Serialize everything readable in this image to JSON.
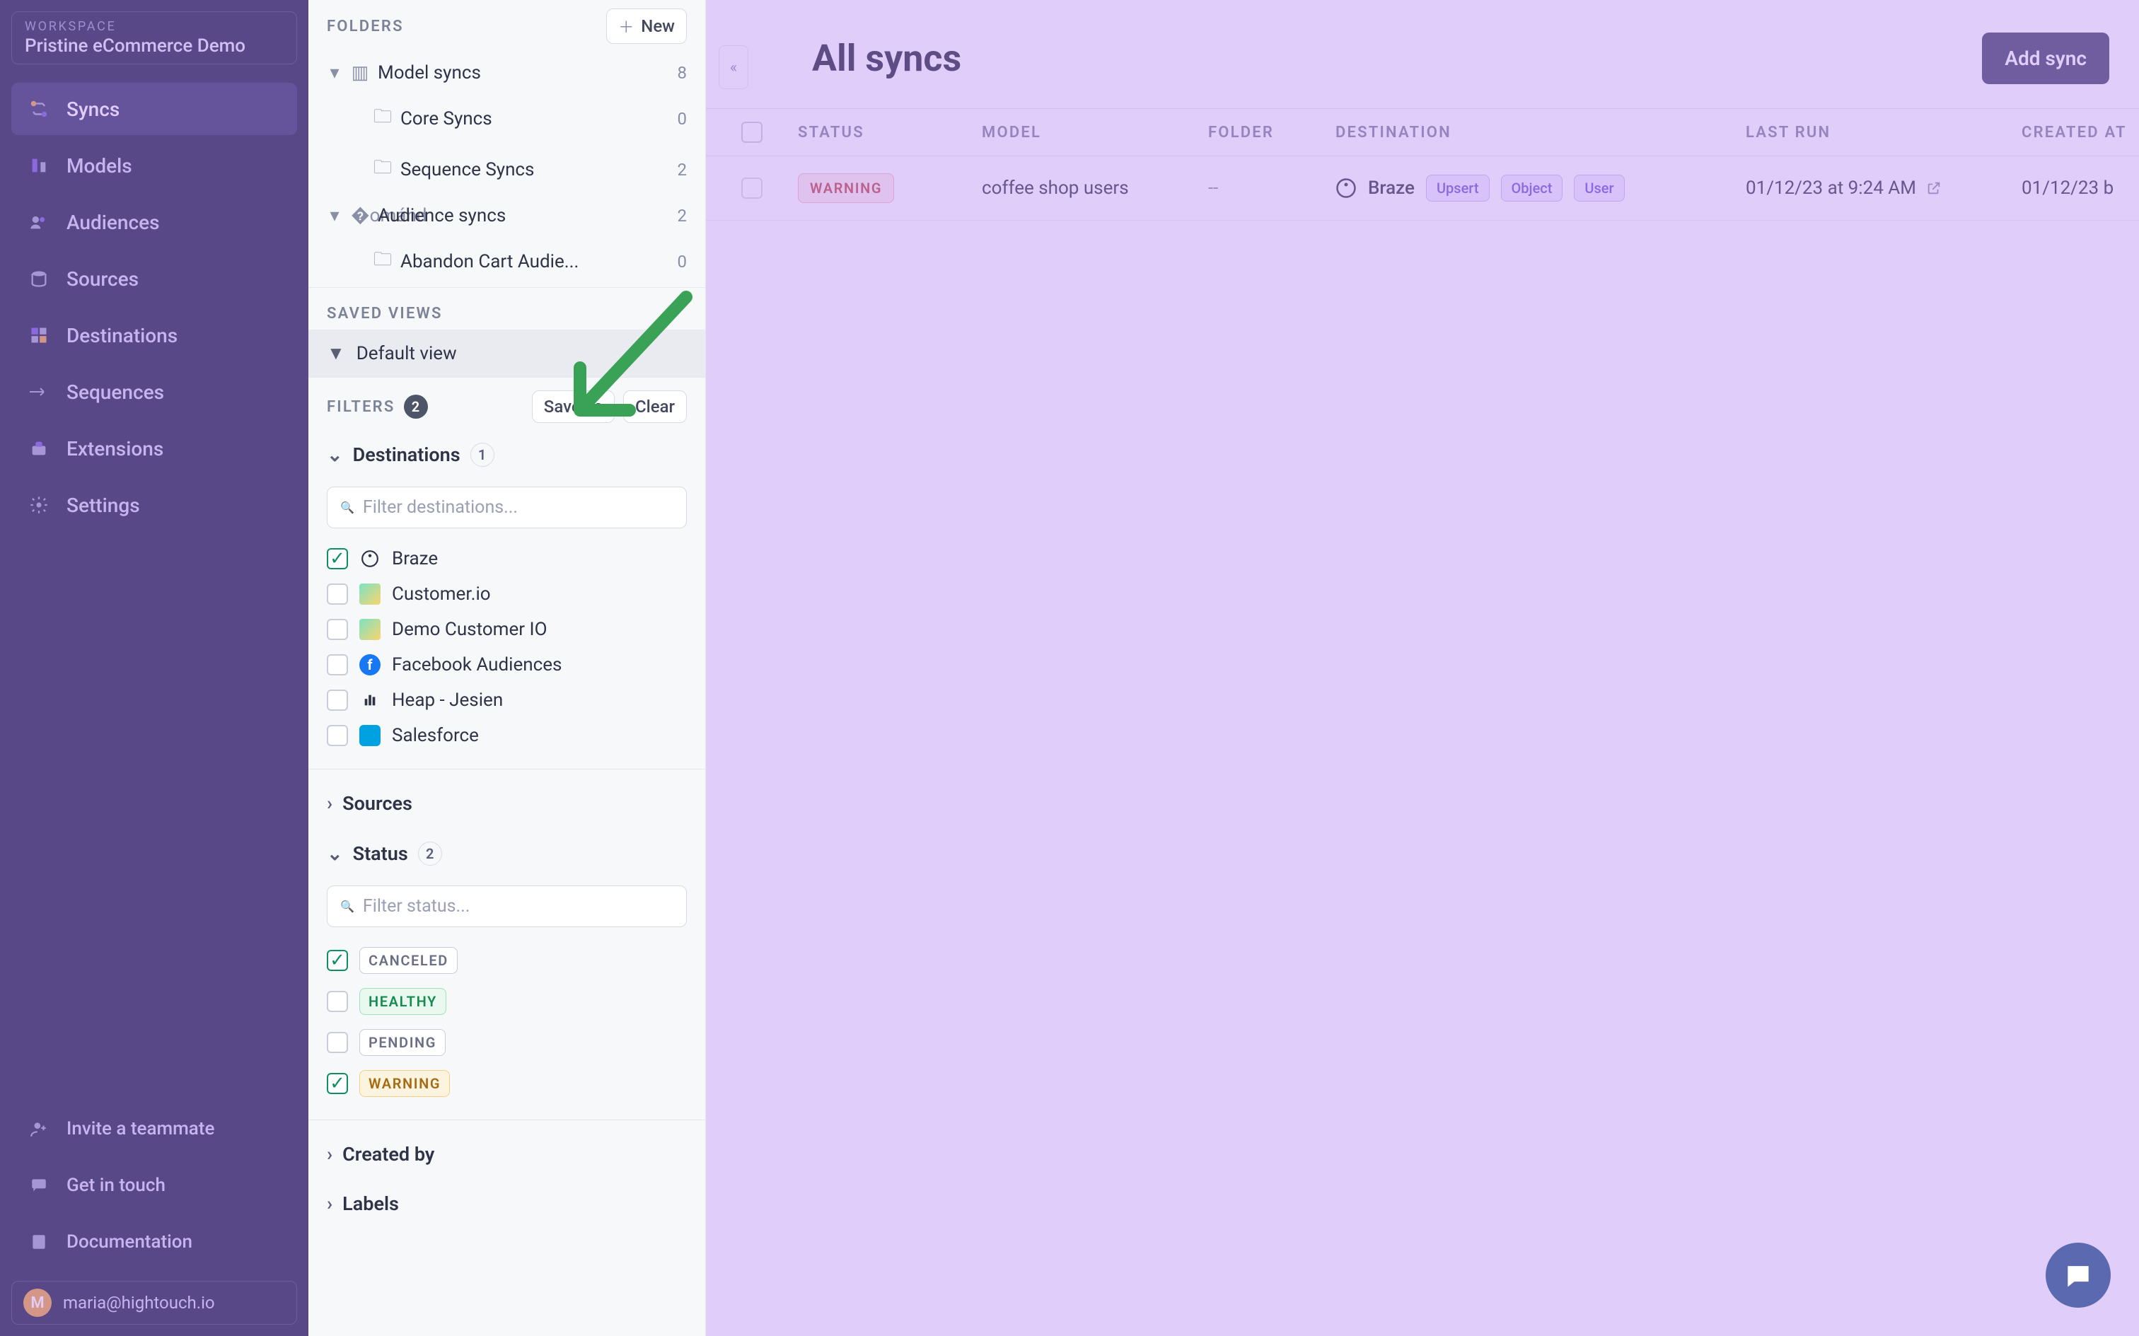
{
  "workspace": {
    "label": "WORKSPACE",
    "name": "Pristine eCommerce Demo"
  },
  "nav": {
    "syncs": "Syncs",
    "models": "Models",
    "audiences": "Audiences",
    "sources": "Sources",
    "destinations": "Destinations",
    "sequences": "Sequences",
    "extensions": "Extensions",
    "settings": "Settings"
  },
  "sidebar_bottom": {
    "invite": "Invite a teammate",
    "contact": "Get in touch",
    "docs": "Documentation"
  },
  "user": {
    "initial": "M",
    "email": "maria@hightouch.io"
  },
  "folders": {
    "heading": "FOLDERS",
    "new_btn": "New",
    "items": [
      {
        "label": "Model syncs",
        "count": "8",
        "kind": "parent"
      },
      {
        "label": "Core Syncs",
        "count": "0",
        "kind": "child"
      },
      {
        "label": "Sequence Syncs",
        "count": "2",
        "kind": "child"
      },
      {
        "label": "Audience syncs",
        "count": "2",
        "kind": "parent"
      },
      {
        "label": "Abandon Cart Audie...",
        "count": "0",
        "kind": "child"
      }
    ]
  },
  "saved_views": {
    "heading": "SAVED VIEWS",
    "default": "Default view"
  },
  "filters": {
    "heading": "FILTERS",
    "count": "2",
    "save_as": "Save as",
    "clear": "Clear",
    "destinations": {
      "label": "Destinations",
      "count": "1",
      "placeholder": "Filter destinations...",
      "options": [
        {
          "label": "Braze",
          "checked": true
        },
        {
          "label": "Customer.io",
          "checked": false
        },
        {
          "label": "Demo Customer IO",
          "checked": false
        },
        {
          "label": "Facebook Audiences",
          "checked": false
        },
        {
          "label": "Heap - Jesien",
          "checked": false
        },
        {
          "label": "Salesforce",
          "checked": false
        }
      ]
    },
    "sources": {
      "label": "Sources"
    },
    "status": {
      "label": "Status",
      "count": "2",
      "placeholder": "Filter status...",
      "options": [
        {
          "label": "CANCELED",
          "cls": "canceled",
          "checked": true
        },
        {
          "label": "HEALTHY",
          "cls": "healthy",
          "checked": false
        },
        {
          "label": "PENDING",
          "cls": "pending",
          "checked": false
        },
        {
          "label": "WARNING",
          "cls": "warning",
          "checked": true
        }
      ]
    },
    "created_by": {
      "label": "Created by"
    },
    "labels": {
      "label": "Labels"
    }
  },
  "main": {
    "title": "All syncs",
    "add_btn": "Add sync",
    "columns": {
      "status": "STATUS",
      "model": "MODEL",
      "folder": "FOLDER",
      "destination": "DESTINATION",
      "last_run": "LAST RUN",
      "created_at": "CREATED AT"
    },
    "rows": [
      {
        "status": "WARNING",
        "model": "coffee shop users",
        "folder": "--",
        "destination": {
          "name": "Braze",
          "tags": [
            "Upsert",
            "Object",
            "User"
          ]
        },
        "last_run": "01/12/23 at 9:24 AM",
        "created_at": "01/12/23  b"
      }
    ]
  }
}
